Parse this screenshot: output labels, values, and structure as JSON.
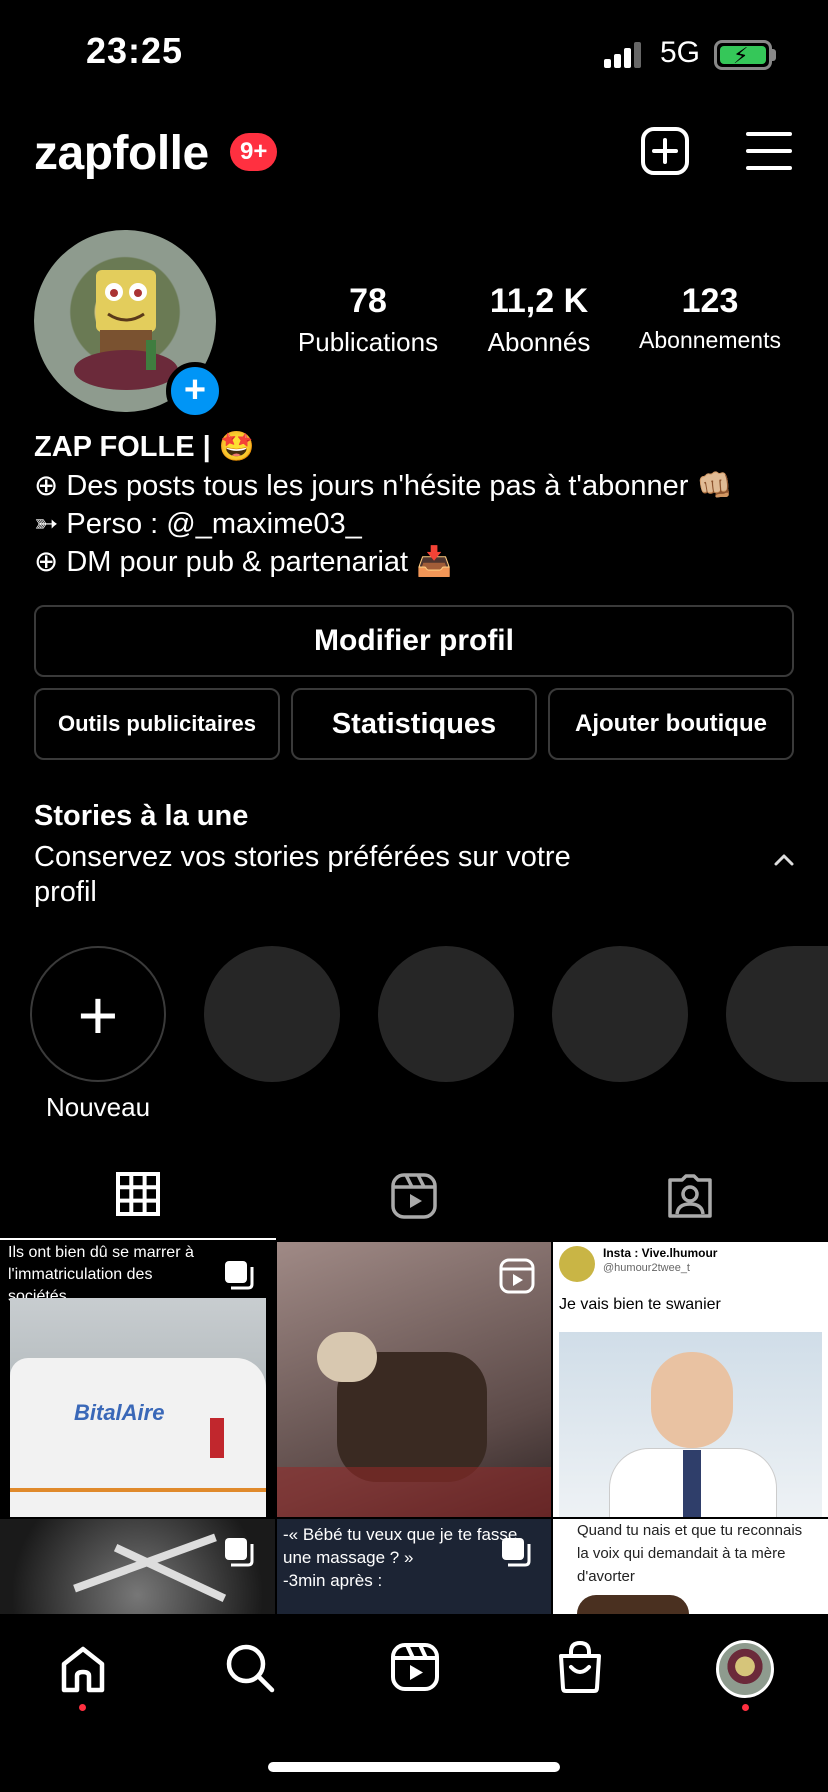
{
  "status_bar": {
    "time": "23:25",
    "network": "5G"
  },
  "header": {
    "username": "zapfolle",
    "notifications_badge": "9+"
  },
  "stats": [
    {
      "value": "78",
      "label": "Publications"
    },
    {
      "value": "11,2 K",
      "label": "Abonnés"
    },
    {
      "value": "123",
      "label": "Abonnements"
    }
  ],
  "bio": {
    "name": "ZAP FOLLE | 🤩",
    "lines": [
      "⊕ Des posts tous les jours n'hésite pas à  t'abonner 👊🏼",
      "➳ Perso : @_maxime03_",
      "⊕ DM pour pub & partenariat 📥"
    ]
  },
  "buttons": {
    "edit_profile": "Modifier profil",
    "ad_tools": "Outils publicitaires",
    "insights": "Statistiques",
    "add_shop": "Ajouter boutique"
  },
  "highlights": {
    "title": "Stories à la une",
    "description": "Conservez vos stories préférées sur votre profil",
    "new_label": "Nouveau"
  },
  "posts": {
    "post1_caption": "Ils ont bien dû se marrer à l'immatriculation des sociétés.",
    "post1_van_text": "BitalAire",
    "post3_account": "Insta : Vive.lhumour",
    "post3_handle": "@humour2twee_t",
    "post3_text": "Je vais bien te swanier",
    "post5_text": "-« Bébé tu veux que je te fasse une massage ? »\n-3min après :",
    "post6_text": "Quand tu nais et que tu reconnais la voix qui demandait à ta mère d'avorter"
  },
  "colors": {
    "background": "#000000",
    "accent_blue": "#0095f6",
    "badge_red": "#ff3040",
    "battery_green": "#35c759",
    "button_border": "#3a3a3a",
    "highlight_placeholder": "#262626"
  }
}
